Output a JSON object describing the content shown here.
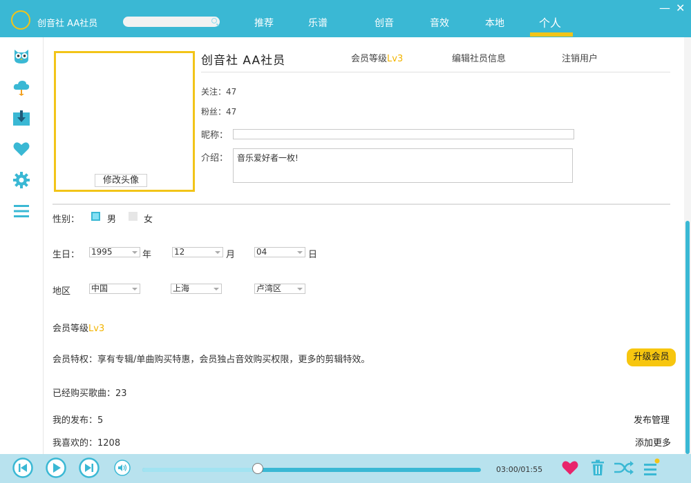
{
  "app": {
    "title": "创音社 AA社员"
  },
  "nav": {
    "tabs": [
      {
        "label": "推荐"
      },
      {
        "label": "乐谱"
      },
      {
        "label": "创音"
      },
      {
        "label": "音效"
      },
      {
        "label": "本地"
      },
      {
        "label": "个人",
        "active": true
      }
    ]
  },
  "window": {
    "minimize": "—",
    "close": "✕"
  },
  "profile": {
    "username": "创音社 AA社员",
    "member_level_label": "会员等级",
    "member_level_value": "Lv3",
    "edit_link": "编辑社员信息",
    "logout_link": "注销用户",
    "avatar_button": "修改头像",
    "follow": "关注：47",
    "fans": "粉丝：47",
    "nickname_label": "昵称：",
    "nickname_value": "",
    "intro_label": "介绍：",
    "intro_value": "音乐爱好者一枚!"
  },
  "form": {
    "gender_label": "性别：",
    "gender_male": "男",
    "gender_female": "女",
    "gender_selected": "男",
    "birthday_label": "生日：",
    "year": "1995",
    "year_unit": "年",
    "month": "12",
    "month_unit": "月",
    "day": "04",
    "day_unit": "日",
    "region_label": "地区",
    "country": "中国",
    "city": "上海",
    "district": "卢湾区"
  },
  "membership": {
    "level_label": "会员等级",
    "level_value": "Lv3",
    "privileges": "会员特权：享有专辑/单曲购买特惠，会员独占音效购买权限，更多的剪辑特效。",
    "upgrade_button": "升级会员",
    "purchased": "已经购买歌曲：23",
    "published": "我的发布：5",
    "publish_manage": "发布管理",
    "liked": "我喜欢的：1208",
    "add_more": "添加更多"
  },
  "player": {
    "time": "03:00/01:55",
    "progress": 0.34
  },
  "colors": {
    "accent": "#3ab8d4",
    "highlight": "#f2c418",
    "heart": "#e8246b"
  },
  "icons": {
    "sidebar": [
      "owl-icon",
      "cloud-icon",
      "download-icon",
      "heart-icon",
      "gear-icon",
      "menu-icon"
    ],
    "player": [
      "previous-icon",
      "play-icon",
      "next-icon",
      "volume-icon",
      "heart-icon",
      "trash-icon",
      "shuffle-icon",
      "playlist-icon"
    ]
  }
}
